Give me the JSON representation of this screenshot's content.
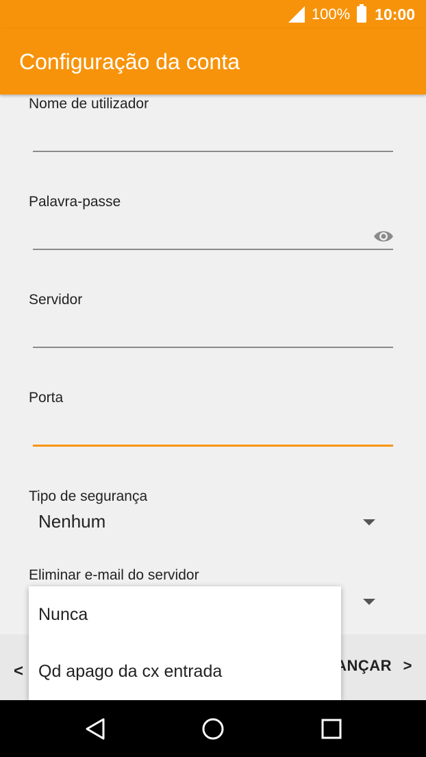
{
  "status_bar": {
    "battery": "100%",
    "time": "10:00"
  },
  "app_bar": {
    "title": "Configuração da conta"
  },
  "form": {
    "username_label": "Nome de utilizador",
    "password_label": "Palavra-passe",
    "server_label": "Servidor",
    "port_label": "Porta",
    "security_label": "Tipo de segurança",
    "security_value": "Nenhum",
    "delete_label": "Eliminar e-mail do servidor"
  },
  "bottom_bar": {
    "back_glyph": "<",
    "next_label": "ANÇAR",
    "next_glyph": ">"
  },
  "popup_menu": {
    "items": [
      "Nunca",
      "Qd apago da cx entrada"
    ]
  },
  "colors": {
    "accent": "#f7930a",
    "nav_background": "#000000"
  },
  "icons": {
    "signal": "signal-icon",
    "battery": "battery-icon",
    "password_toggle": "eye-icon",
    "nav_back": "back-triangle-icon",
    "nav_home": "home-circle-icon",
    "nav_recents": "recents-square-icon"
  }
}
